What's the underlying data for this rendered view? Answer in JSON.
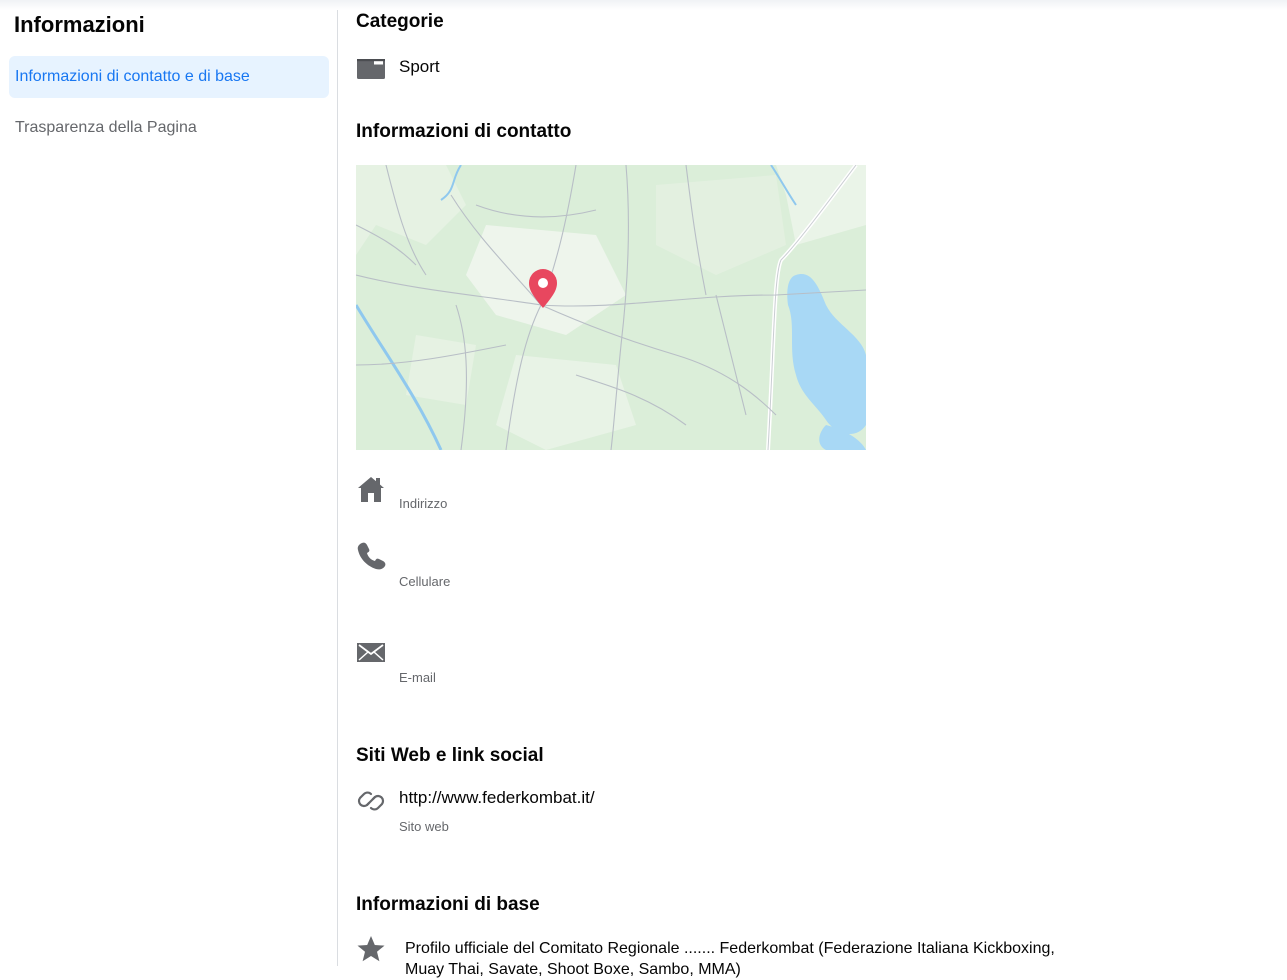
{
  "sidebar": {
    "title": "Informazioni",
    "items": [
      {
        "label": "Informazioni di contatto e di base",
        "active": true
      },
      {
        "label": "Trasparenza della Pagina",
        "active": false
      }
    ]
  },
  "main": {
    "categories": {
      "heading": "Categorie",
      "items": [
        {
          "icon": "category-folder-icon",
          "label": "Sport"
        }
      ]
    },
    "contact": {
      "heading": "Informazioni di contatto",
      "map": {
        "marker": "map-pin-icon",
        "marker_color": "#e8475f",
        "water_color": "#a8d8f5",
        "land_color": "#dbeed9"
      },
      "address": {
        "icon": "home-icon",
        "label": "Indirizzo"
      },
      "phone": {
        "icon": "phone-icon",
        "label": "Cellulare"
      },
      "email": {
        "icon": "envelope-icon",
        "label": "E-mail"
      }
    },
    "websites": {
      "heading": "Siti Web e link social",
      "items": [
        {
          "icon": "link-icon",
          "url": "http://www.federkombat.it/",
          "label": "Sito web"
        }
      ]
    },
    "basic": {
      "heading": "Informazioni di base",
      "items": [
        {
          "icon": "star-icon",
          "text": "Profilo ufficiale del Comitato Regionale ....... Federkombat (Federazione Italiana Kickboxing, Muay Thai, Savate, Shoot Boxe, Sambo, MMA)"
        }
      ]
    }
  },
  "colors": {
    "accent": "#1877f2",
    "active_bg": "#e7f3ff",
    "secondary_text": "#65676b",
    "icon": "#65676b"
  }
}
